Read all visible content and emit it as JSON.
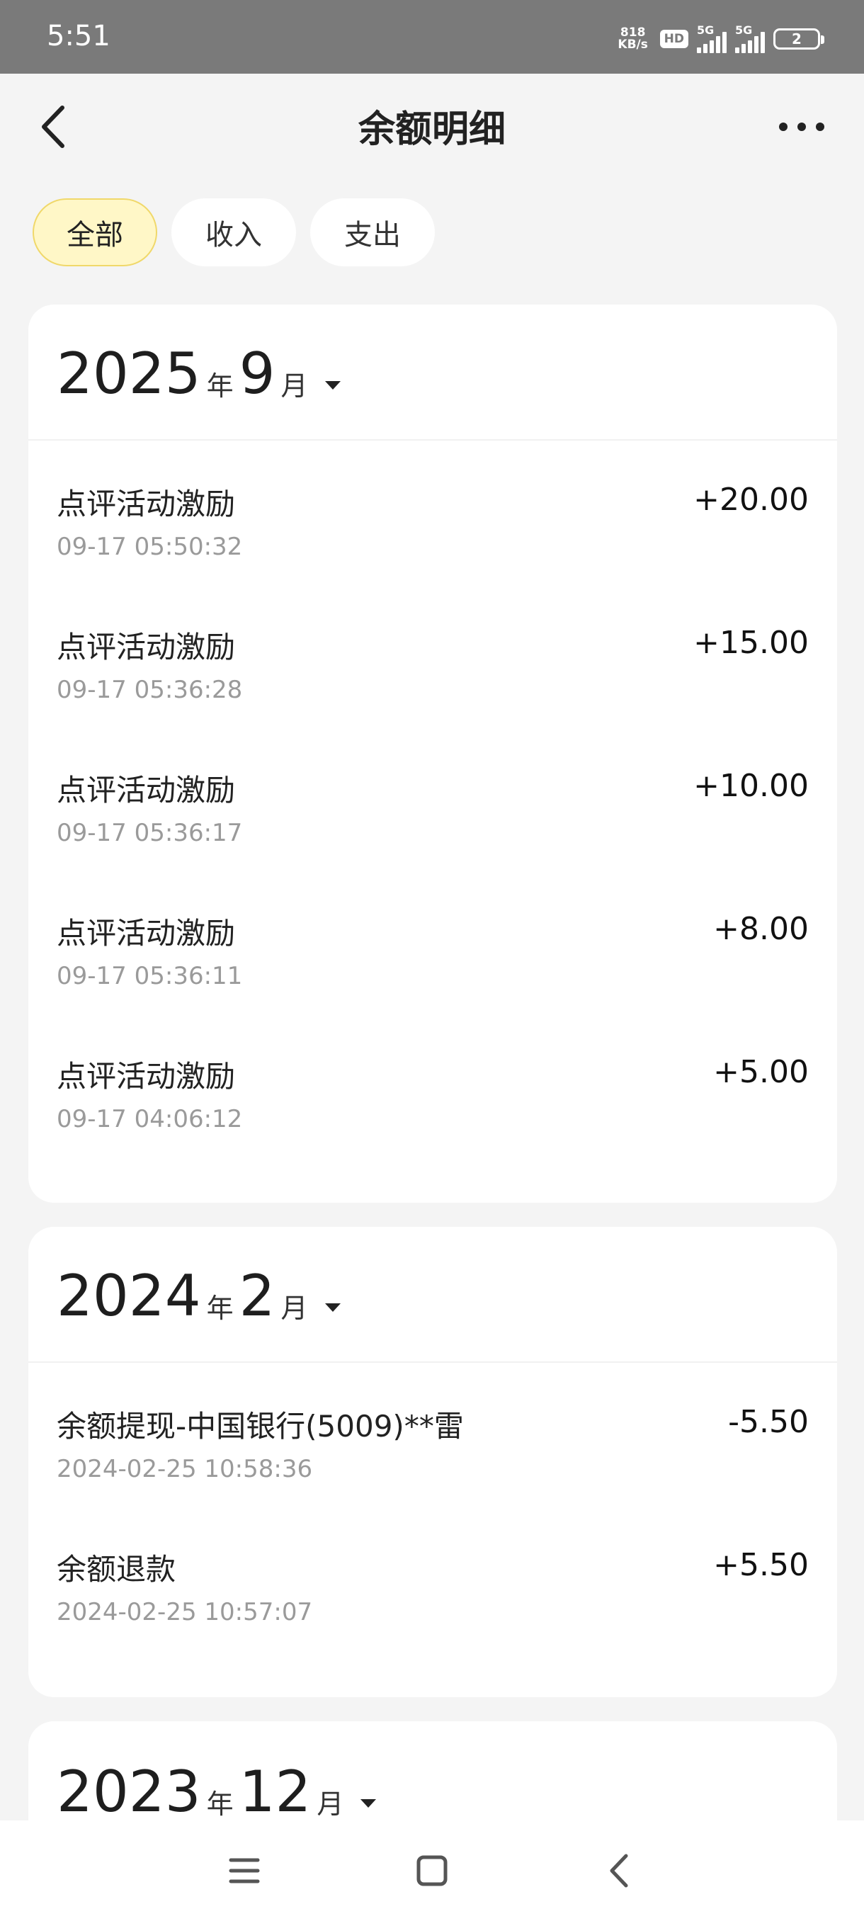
{
  "status_bar": {
    "time": "5:51",
    "net_speed_value": "818",
    "net_speed_unit": "KB/s",
    "hd_label": "HD",
    "sig1_label": "5G",
    "sig2_label": "5G",
    "battery": "2"
  },
  "header": {
    "title": "余额明细"
  },
  "filters": [
    {
      "label": "全部",
      "active": true
    },
    {
      "label": "收入",
      "active": false
    },
    {
      "label": "支出",
      "active": false
    }
  ],
  "months": [
    {
      "year": "2025",
      "year_unit": "年",
      "month": "9",
      "month_unit": "月",
      "items": [
        {
          "title": "点评活动激励",
          "time": "09-17 05:50:32",
          "amount": "+20.00"
        },
        {
          "title": "点评活动激励",
          "time": "09-17 05:36:28",
          "amount": "+15.00"
        },
        {
          "title": "点评活动激励",
          "time": "09-17 05:36:17",
          "amount": "+10.00"
        },
        {
          "title": "点评活动激励",
          "time": "09-17 05:36:11",
          "amount": "+8.00"
        },
        {
          "title": "点评活动激励",
          "time": "09-17 04:06:12",
          "amount": "+5.00"
        }
      ]
    },
    {
      "year": "2024",
      "year_unit": "年",
      "month": "2",
      "month_unit": "月",
      "items": [
        {
          "title": "余额提现-中国银行(5009)**雷",
          "time": "2024-02-25 10:58:36",
          "amount": "-5.50"
        },
        {
          "title": "余额退款",
          "time": "2024-02-25 10:57:07",
          "amount": "+5.50"
        }
      ]
    },
    {
      "year": "2023",
      "year_unit": "年",
      "month": "12",
      "month_unit": "月",
      "items": []
    }
  ],
  "colors": {
    "accent_chip_bg": "#fff7c7",
    "accent_chip_border": "#f0d86a",
    "status_bar_bg": "#7a7a7a",
    "page_bg": "#f4f4f4"
  },
  "icons": {
    "back": "chevron-left-icon",
    "more": "more-dots-icon",
    "nav_menu": "menu-icon",
    "nav_home": "home-square-icon",
    "nav_back": "nav-back-icon"
  }
}
